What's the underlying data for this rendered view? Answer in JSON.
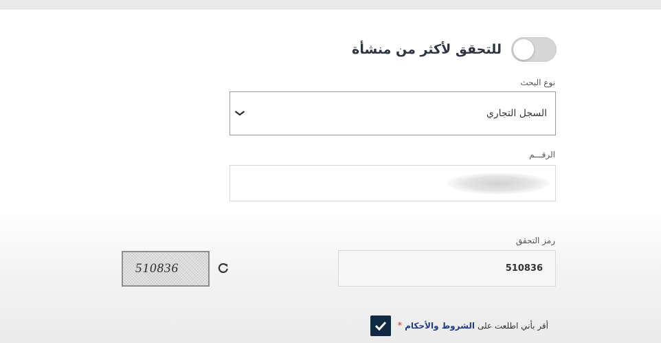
{
  "verify_multiple": {
    "label": "للتحقق لأكثر من منشأة",
    "toggle_on": false
  },
  "search_type": {
    "label": "نوع البحث",
    "selected": "السجل التجاري"
  },
  "number": {
    "label": "الرقـــم",
    "value": ""
  },
  "captcha": {
    "label": "رمز التحقق",
    "input_value": "510836",
    "image_text": "510836"
  },
  "terms": {
    "prefix": "أقر بأني اطلعت على",
    "link": "الشروط والأحكام",
    "required_mark": "*",
    "checked": true
  },
  "colors": {
    "checkbox": "#102a43",
    "link": "#1f3c88",
    "required": "#d0342c",
    "toggle_off": "#d6d6d6"
  },
  "icons": {
    "dropdown": "chevron-down-icon",
    "refresh": "refresh-icon",
    "check": "check-icon"
  }
}
